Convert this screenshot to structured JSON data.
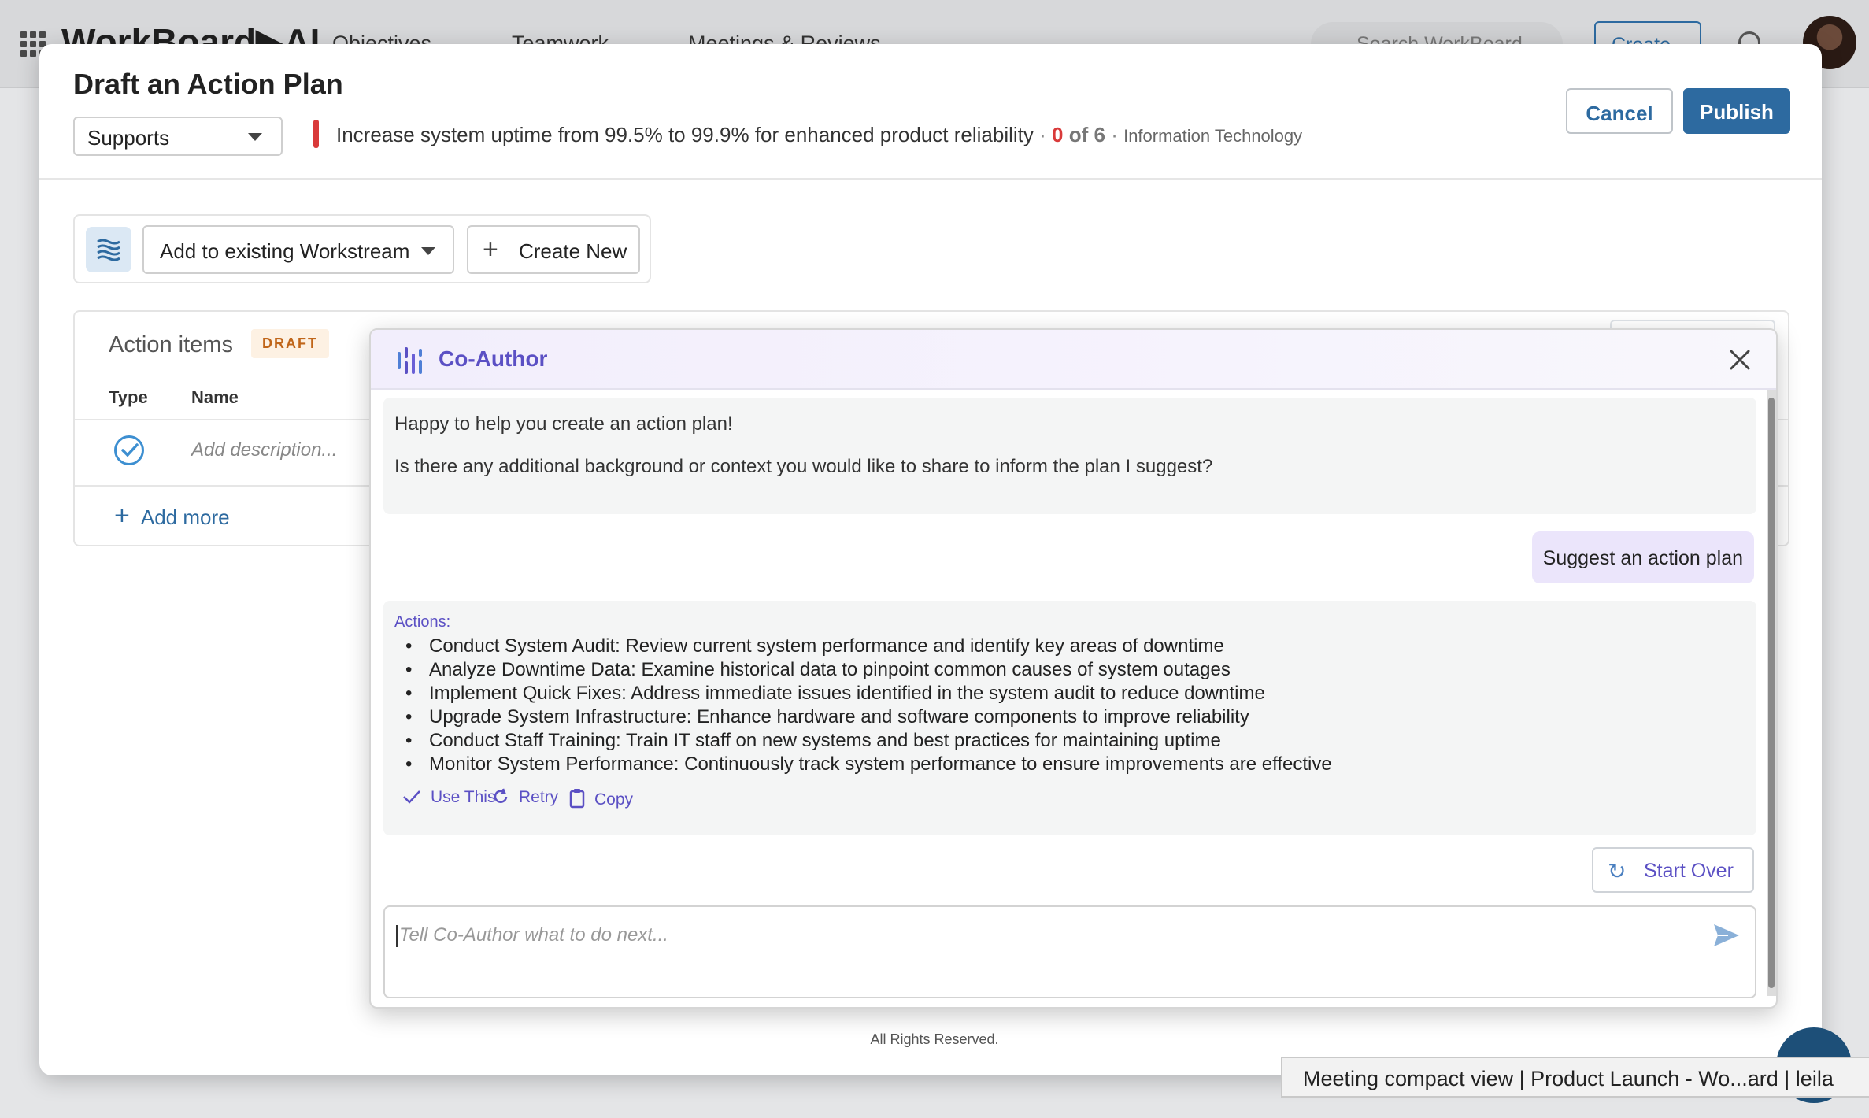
{
  "topnav": {
    "logo": "WorkBoard▶AI",
    "items": [
      "Objectives",
      "Teamwork",
      "Meetings & Reviews"
    ],
    "search_placeholder": "Search WorkBoard",
    "create_label": "Create"
  },
  "modal": {
    "title": "Draft an Action Plan",
    "supports_label": "Supports",
    "objective_text": "Increase system uptime from 99.5% to 99.9% for enhanced product reliability",
    "progress_done": "0",
    "progress_of": " of 6",
    "department": "Information Technology",
    "cancel_label": "Cancel",
    "publish_label": "Publish"
  },
  "workstream": {
    "select_label": "Add to existing Workstream",
    "create_label": "Create New"
  },
  "action_items": {
    "title": "Action items",
    "badge": "DRAFT",
    "col_type": "Type",
    "col_name": "Name",
    "row_placeholder": "Add description...",
    "add_more": "Add more"
  },
  "coauthor": {
    "title": "Co-Author",
    "greeting_line1": "Happy to help you create an action plan!",
    "greeting_line2": "Is there any additional background or context you would like to share to inform the plan I suggest?",
    "user_message": "Suggest an action plan",
    "actions_label": "Actions:",
    "actions": [
      "Conduct System Audit: Review current system performance and identify key areas of downtime",
      "Analyze Downtime Data: Examine historical data to pinpoint common causes of system outages",
      "Implement Quick Fixes: Address immediate issues identified in the system audit to reduce downtime",
      "Upgrade System Infrastructure: Enhance hardware and software components to improve reliability",
      "Conduct Staff Training: Train IT staff on new systems and best practices for maintaining uptime",
      "Monitor System Performance: Continuously track system performance to ensure improvements are effective"
    ],
    "use_this": "Use This",
    "retry": "Retry",
    "copy": "Copy",
    "start_over": "Start Over",
    "input_placeholder": "Tell Co-Author what to do next..."
  },
  "footer": {
    "rights": "All Rights Reserved."
  },
  "tooltip": {
    "text": "Meeting compact view | Product Launch - Wo...ard | leila"
  },
  "colors": {
    "accent_blue": "#2d6aa0",
    "coauthor_purple": "#5b50c4",
    "progress_red": "#d93a3a",
    "draft_orange": "#c0661a"
  }
}
